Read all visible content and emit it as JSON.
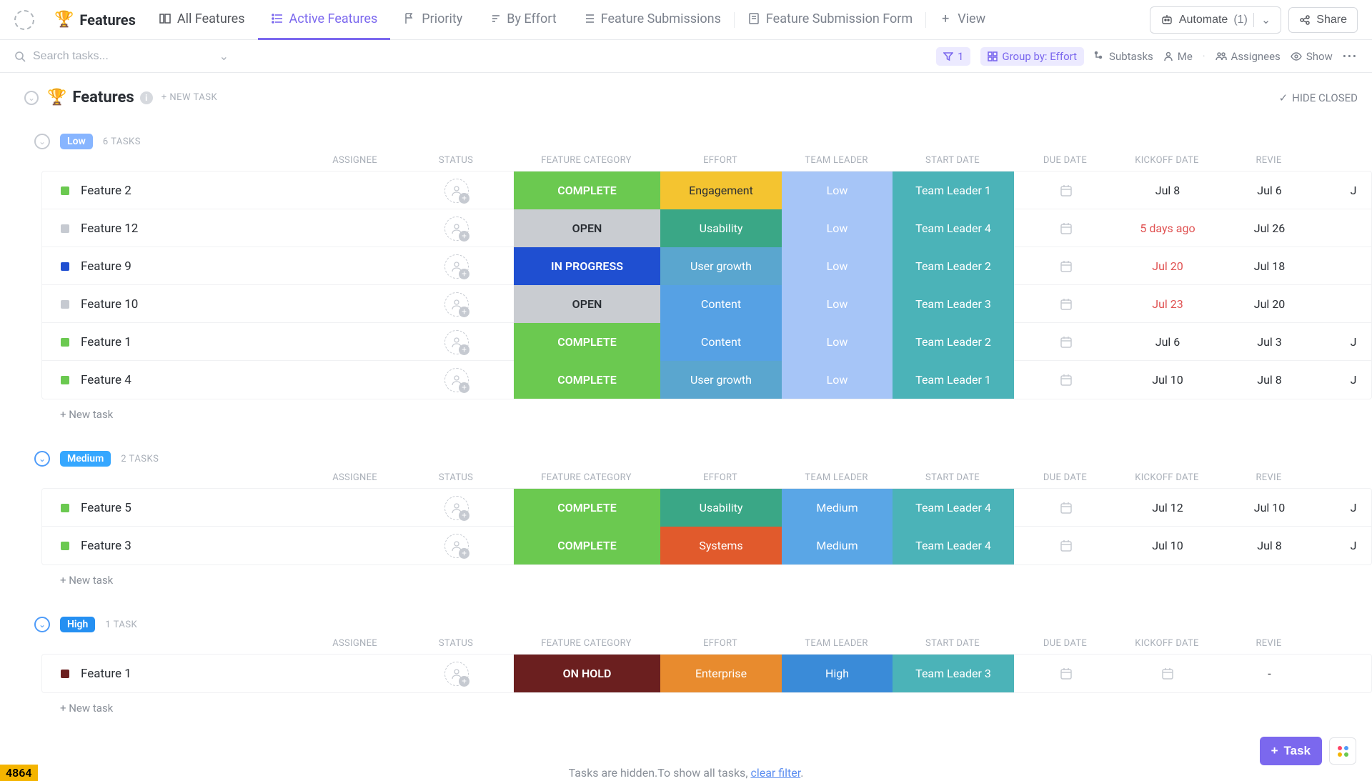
{
  "header": {
    "page_title": "Features",
    "tabs": [
      {
        "label": "All Features",
        "active": false
      },
      {
        "label": "Active Features",
        "active": true
      },
      {
        "label": "Priority",
        "active": false
      },
      {
        "label": "By Effort",
        "active": false
      },
      {
        "label": "Feature Submissions",
        "active": false
      },
      {
        "label": "Feature Submission Form",
        "active": false
      }
    ],
    "add_view": "View",
    "automate_label": "Automate",
    "automate_count": "(1)",
    "share_label": "Share"
  },
  "toolbar": {
    "search_placeholder": "Search tasks...",
    "filter_count": "1",
    "group_by_label": "Group by: Effort",
    "subtasks": "Subtasks",
    "me": "Me",
    "assignees": "Assignees",
    "show": "Show"
  },
  "list": {
    "title": "Features",
    "new_task_header": "+ NEW TASK",
    "hide_closed": "HIDE CLOSED",
    "columns": [
      "ASSIGNEE",
      "STATUS",
      "FEATURE CATEGORY",
      "EFFORT",
      "TEAM LEADER",
      "START DATE",
      "DUE DATE",
      "KICKOFF DATE",
      "REVIE"
    ],
    "new_task_row": "+ New task"
  },
  "groups": [
    {
      "key": "low",
      "badge": "Low",
      "badge_class": "low",
      "count": "6 TASKS",
      "rows": [
        {
          "dot": "green",
          "name": "Feature 2",
          "status": "COMPLETE",
          "status_cls": "complete",
          "cat": "Engagement",
          "cat_cls": "engagement",
          "effort": "Low",
          "eff_cls": "low",
          "leader": "Team Leader 1",
          "due": "Jul 8",
          "due_red": false,
          "kick": "Jul 6",
          "rev": "J"
        },
        {
          "dot": "gray",
          "name": "Feature 12",
          "status": "OPEN",
          "status_cls": "open",
          "cat": "Usability",
          "cat_cls": "usability",
          "effort": "Low",
          "eff_cls": "low",
          "leader": "Team Leader 4",
          "due": "5 days ago",
          "due_red": true,
          "kick": "Jul 26",
          "rev": ""
        },
        {
          "dot": "blue",
          "name": "Feature 9",
          "status": "IN PROGRESS",
          "status_cls": "progress",
          "cat": "User growth",
          "cat_cls": "usergrowth",
          "effort": "Low",
          "eff_cls": "low",
          "leader": "Team Leader 2",
          "due": "Jul 20",
          "due_red": true,
          "kick": "Jul 18",
          "rev": ""
        },
        {
          "dot": "gray",
          "name": "Feature 10",
          "status": "OPEN",
          "status_cls": "open",
          "cat": "Content",
          "cat_cls": "content",
          "effort": "Low",
          "eff_cls": "low",
          "leader": "Team Leader 3",
          "due": "Jul 23",
          "due_red": true,
          "kick": "Jul 20",
          "rev": ""
        },
        {
          "dot": "green",
          "name": "Feature 1",
          "status": "COMPLETE",
          "status_cls": "complete",
          "cat": "Content",
          "cat_cls": "content",
          "effort": "Low",
          "eff_cls": "low",
          "leader": "Team Leader 2",
          "due": "Jul 6",
          "due_red": false,
          "kick": "Jul 3",
          "rev": "J"
        },
        {
          "dot": "green",
          "name": "Feature 4",
          "status": "COMPLETE",
          "status_cls": "complete",
          "cat": "User growth",
          "cat_cls": "usergrowth",
          "effort": "Low",
          "eff_cls": "low",
          "leader": "Team Leader 1",
          "due": "Jul 10",
          "due_red": false,
          "kick": "Jul 8",
          "rev": "J"
        }
      ]
    },
    {
      "key": "medium",
      "badge": "Medium",
      "badge_class": "medium",
      "count": "2 TASKS",
      "rows": [
        {
          "dot": "green",
          "name": "Feature 5",
          "status": "COMPLETE",
          "status_cls": "complete",
          "cat": "Usability",
          "cat_cls": "usability",
          "effort": "Medium",
          "eff_cls": "medium",
          "leader": "Team Leader 4",
          "due": "Jul 12",
          "due_red": false,
          "kick": "Jul 10",
          "rev": "J"
        },
        {
          "dot": "green",
          "name": "Feature 3",
          "status": "COMPLETE",
          "status_cls": "complete",
          "cat": "Systems",
          "cat_cls": "systems",
          "effort": "Medium",
          "eff_cls": "medium",
          "leader": "Team Leader 4",
          "due": "Jul 10",
          "due_red": false,
          "kick": "Jul 8",
          "rev": "J"
        }
      ]
    },
    {
      "key": "high",
      "badge": "High",
      "badge_class": "high",
      "count": "1 TASK",
      "rows": [
        {
          "dot": "darkred",
          "name": "Feature 1",
          "status": "ON HOLD",
          "status_cls": "hold",
          "cat": "Enterprise",
          "cat_cls": "enterprise",
          "effort": "High",
          "eff_cls": "high",
          "leader": "Team Leader 3",
          "due": "",
          "due_red": false,
          "kick": "-",
          "rev": "",
          "due_is_cal": true
        }
      ]
    }
  ],
  "hidden_note": {
    "text": "Tasks are hidden.To show all tasks, ",
    "link": "clear filter",
    "suffix": "."
  },
  "fab": {
    "task": "Task"
  },
  "bl_badge": "4864"
}
